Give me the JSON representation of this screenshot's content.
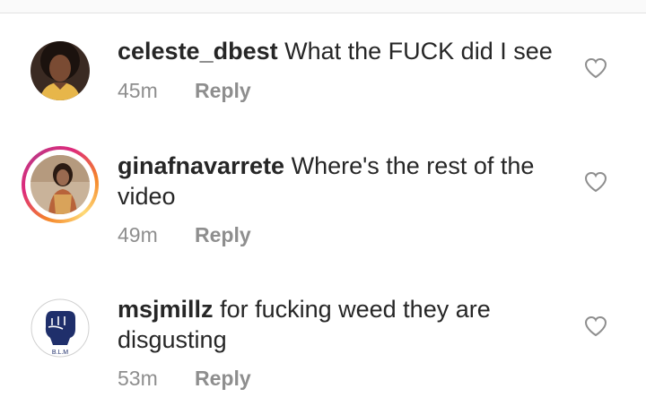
{
  "comments": [
    {
      "username": "celeste_dbest",
      "text": "What the FUCK did I see",
      "time": "45m",
      "reply_label": "Reply",
      "avatar": "woman-portrait",
      "has_story_ring": false
    },
    {
      "username": "ginafnavarrete",
      "text": "Where's the rest of the video",
      "time": "49m",
      "reply_label": "Reply",
      "avatar": "woman-portrait",
      "has_story_ring": true
    },
    {
      "username": "msjmillz",
      "text": "for fucking weed they are disgusting",
      "time": "53m",
      "reply_label": "Reply",
      "avatar": "raised-fist-logo",
      "avatar_text": "B.L.M",
      "has_story_ring": false
    }
  ],
  "icons": {
    "like": "heart-outline-icon"
  },
  "colors": {
    "text": "#262626",
    "secondary": "#8e8e8e",
    "fist_blue": "#1f2f6b"
  }
}
